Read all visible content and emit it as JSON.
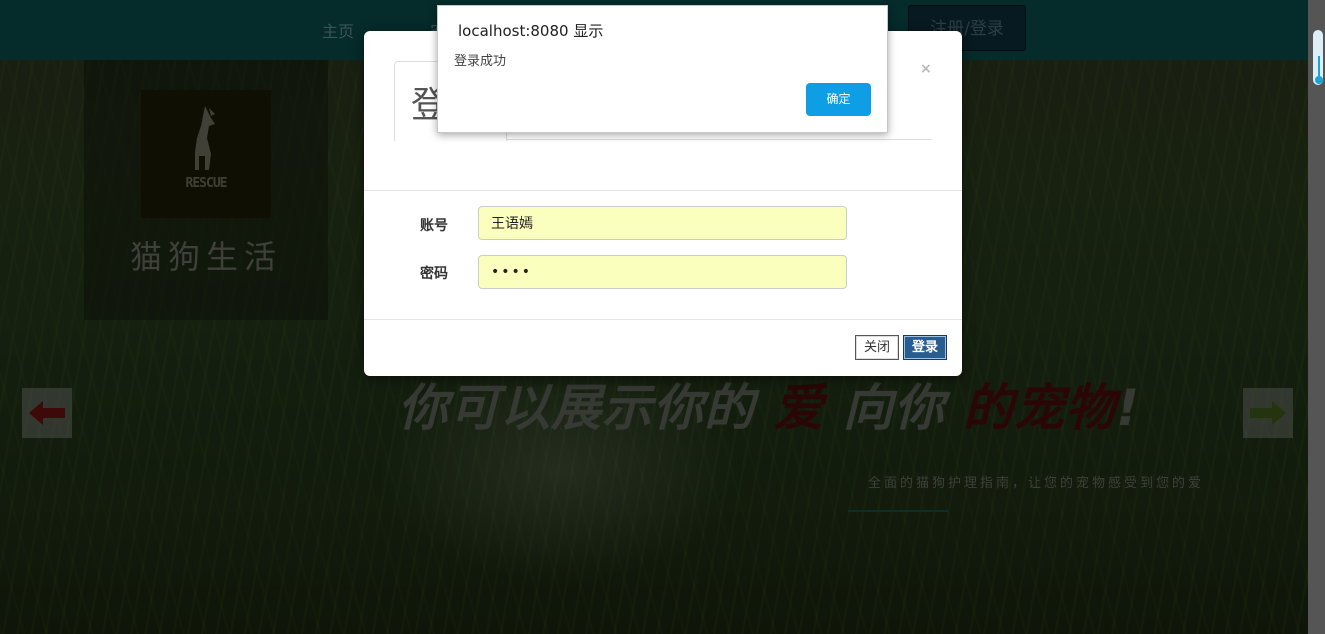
{
  "navbar": {
    "home_label": "主页",
    "second_label": "宠",
    "register_login_label": "注册/登录"
  },
  "brand": {
    "logo_text": "RESCUE",
    "title": "猫狗生活"
  },
  "hero": {
    "part1": "你可以展示你的",
    "part2": "爱",
    "part3": "向你",
    "part4": "的宠物",
    "part5": "!",
    "tagline": "全面的猫狗护理指南，让您的宠物感受到您的爱"
  },
  "modal": {
    "tab_label": "登",
    "close_symbol": "×",
    "account_label": "账号",
    "account_value": "王语嫣",
    "password_label": "密码",
    "password_value": "••••",
    "close_button": "关闭",
    "login_button": "登录"
  },
  "alert": {
    "title": "localhost:8080 显示",
    "message": "登录成功",
    "ok_button": "确定"
  },
  "colors": {
    "navbar": "#0a4b4b",
    "alert_button": "#0e9ee6",
    "login_button": "#2a5d8f",
    "autofill": "#faffbd",
    "hero_accent": "#4a0c0c"
  },
  "icons": {
    "left_arrow": "arrow-left-icon",
    "right_arrow": "arrow-right-icon",
    "logo": "dog-logo-icon"
  }
}
